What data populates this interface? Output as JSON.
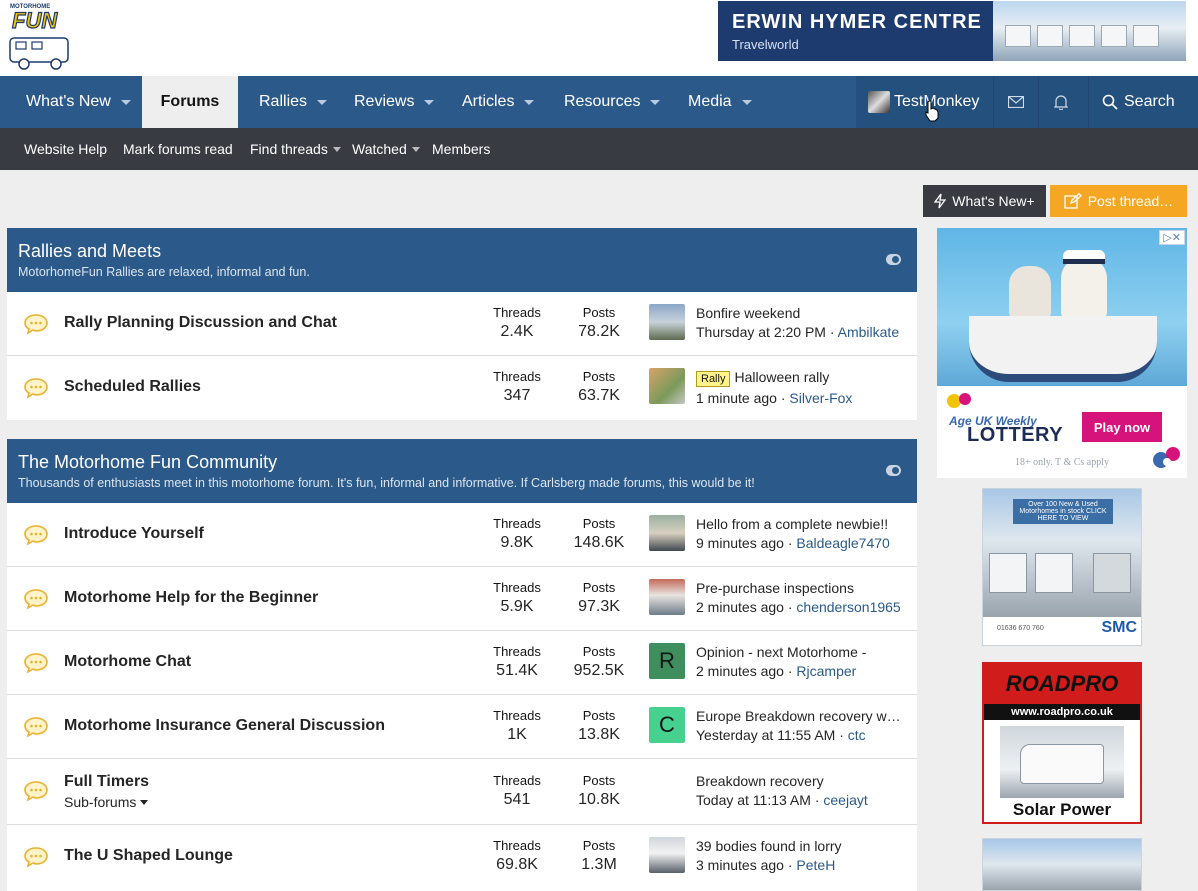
{
  "header": {
    "logo_text": "FUN",
    "logo_small": "MOTORHOME",
    "banner": {
      "title": "ERWIN HYMER CENTRE",
      "subtitle": "Travelworld"
    }
  },
  "nav": {
    "items": [
      {
        "label": "What's New"
      },
      {
        "label": "Forums"
      },
      {
        "label": "Rallies"
      },
      {
        "label": "Reviews"
      },
      {
        "label": "Articles"
      },
      {
        "label": "Resources"
      },
      {
        "label": "Media"
      }
    ],
    "user": "TestMonkey",
    "search": "Search"
  },
  "subnav": {
    "items": [
      {
        "label": "Website Help"
      },
      {
        "label": "Mark forums read"
      },
      {
        "label": "Find threads"
      },
      {
        "label": "Watched"
      },
      {
        "label": "Members"
      }
    ]
  },
  "actions": {
    "whats_new": "What's New+",
    "post_thread": "Post thread…"
  },
  "categories": [
    {
      "title": "Rallies and Meets",
      "desc": "MotorhomeFun Rallies are relaxed, informal and fun.",
      "forums": [
        {
          "name": "Rally Planning Discussion and Chat",
          "threads_label": "Threads",
          "threads": "2.4K",
          "posts_label": "Posts",
          "posts": "78.2K",
          "latest_title": "Bonfire weekend",
          "latest_prefix": "",
          "latest_time": "Thursday at 2:20 PM",
          "latest_sep": "·",
          "latest_user": "Ambilkate"
        },
        {
          "name": "Scheduled Rallies",
          "threads_label": "Threads",
          "threads": "347",
          "posts_label": "Posts",
          "posts": "63.7K",
          "latest_title": "Halloween rally",
          "latest_prefix": "Rally",
          "latest_time": "1 minute ago",
          "latest_sep": "·",
          "latest_user": "Silver-Fox"
        }
      ]
    },
    {
      "title": "The Motorhome Fun Community",
      "desc": "Thousands of enthusiasts meet in this motorhome forum. It's fun, informal and informative. If Carlsberg made forums, this would be it!",
      "forums": [
        {
          "name": "Introduce Yourself",
          "threads_label": "Threads",
          "threads": "9.8K",
          "posts_label": "Posts",
          "posts": "148.6K",
          "latest_title": "Hello from a complete newbie!!",
          "latest_time": "9 minutes ago",
          "latest_sep": "·",
          "latest_user": "Baldeagle7470"
        },
        {
          "name": "Motorhome Help for the Beginner",
          "threads_label": "Threads",
          "threads": "5.9K",
          "posts_label": "Posts",
          "posts": "97.3K",
          "latest_title": "Pre-purchase inspections",
          "latest_time": "2 minutes ago",
          "latest_sep": "·",
          "latest_user": "chenderson1965"
        },
        {
          "name": "Motorhome Chat",
          "threads_label": "Threads",
          "threads": "51.4K",
          "posts_label": "Posts",
          "posts": "952.5K",
          "latest_title": "Opinion - next Motorhome -",
          "latest_time": "2 minutes ago",
          "latest_sep": "·",
          "latest_user": "Rjcamper",
          "avatar_letter": "R",
          "avatar_color": "#3f8f5e"
        },
        {
          "name": "Motorhome Insurance General Discussion",
          "threads_label": "Threads",
          "threads": "1K",
          "posts_label": "Posts",
          "posts": "13.8K",
          "latest_title": "Europe Breakdown recovery w…",
          "latest_time": "Yesterday at 11:55 AM",
          "latest_sep": "·",
          "latest_user": "ctc",
          "avatar_letter": "C",
          "avatar_color": "#47d18f"
        },
        {
          "name": "Full Timers",
          "subforums": "Sub-forums",
          "threads_label": "Threads",
          "threads": "541",
          "posts_label": "Posts",
          "posts": "10.8K",
          "latest_title": "Breakdown recovery",
          "latest_time": "Today at 11:13 AM",
          "latest_sep": "·",
          "latest_user": "ceejayt"
        },
        {
          "name": "The U Shaped Lounge",
          "threads_label": "Threads",
          "threads": "69.8K",
          "posts_label": "Posts",
          "posts": "1.3M",
          "latest_title": "39 bodies found in lorry",
          "latest_time": "3 minutes ago",
          "latest_sep": "·",
          "latest_user": "PeteH"
        }
      ]
    }
  ],
  "ads": {
    "ad1": {
      "adchoices": "▷✕",
      "lotto_top": "Age UK Weekly",
      "lotto": "LOTTERY",
      "play": "Play now",
      "tcs": "18+ only. T & Cs apply"
    },
    "ad2": {
      "overlay": "Over 100 New & Used Motorhomes in stock CLICK HERE TO VIEW",
      "phone": "01636 670 760",
      "brand": "SMC"
    },
    "ad3": {
      "brand": "ROADPRO",
      "url": "www.roadpro.co.uk",
      "caption": "Solar Power"
    }
  },
  "colors": {
    "nav": "#2b5a8a",
    "subnav": "#383c42",
    "accent": "#f5a623"
  }
}
